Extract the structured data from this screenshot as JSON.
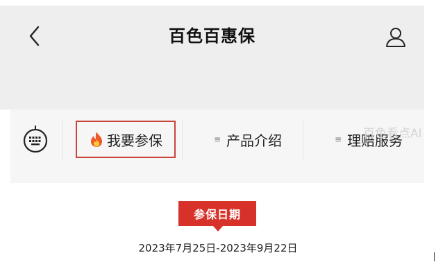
{
  "header": {
    "title": "百色百惠保",
    "back_icon": "chevron-left-icon",
    "user_icon": "user-icon"
  },
  "nav": {
    "keyboard_icon": "keyboard-icon",
    "items": [
      {
        "label": "我要参保",
        "icon": "fire-icon",
        "active": true
      },
      {
        "label": "产品介绍",
        "icon": "menu-icon",
        "active": false
      },
      {
        "label": "理赔服务",
        "icon": "menu-icon",
        "active": false
      }
    ],
    "watermark": "百色看点AI"
  },
  "enrollment": {
    "badge_label": "参保日期",
    "date_range": "2023年7月25日-2023年9月22日"
  },
  "colors": {
    "header_bg": "#eeeeee",
    "nav_bg": "#f6f6f6",
    "accent_red": "#d7322a",
    "active_border": "#c9453a"
  }
}
